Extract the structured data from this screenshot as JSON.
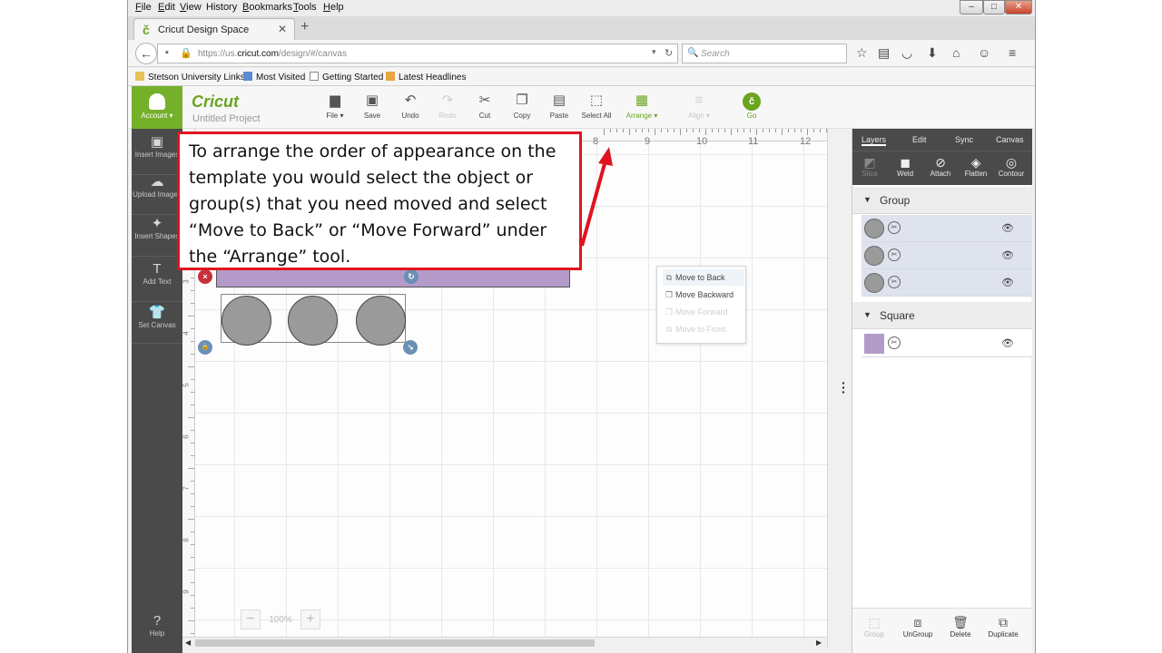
{
  "menubar": {
    "items": [
      {
        "key": "F",
        "rest": "ile"
      },
      {
        "key": "E",
        "rest": "dit"
      },
      {
        "key": "V",
        "rest": "iew"
      },
      {
        "key": "",
        "rest": "History"
      },
      {
        "key": "B",
        "rest": "ookmarks"
      },
      {
        "key": "T",
        "rest": "ools"
      },
      {
        "key": "H",
        "rest": "elp"
      }
    ]
  },
  "window_controls": {
    "minimize": "–",
    "maximize": "□",
    "close": "✕"
  },
  "tab": {
    "title": "Cricut Design Space",
    "favicon": "č",
    "close": "✕",
    "new_tab": "+"
  },
  "nav": {
    "url_prefix": "https://us.",
    "url_domain": "cricut.com",
    "url_rest": "/design/#/canvas",
    "search_placeholder": "Search",
    "icons": [
      "back-arrow-icon",
      "info-icon",
      "lock-icon",
      "reload-icon",
      "search-icon",
      "bookmark-star-icon",
      "reading-list-icon",
      "pocket-icon",
      "download-icon",
      "home-icon",
      "chat-icon",
      "menu-icon"
    ]
  },
  "bookmarks": [
    "Stetson University Links",
    "Most Visited",
    "Getting Started",
    "Latest Headlines"
  ],
  "app": {
    "account_label": "Account ▾",
    "logo_text": "Cricut",
    "project_name": "Untitled Project",
    "toolbar": [
      {
        "label": "File ▾",
        "icon": "▆",
        "state": "normal"
      },
      {
        "label": "Save",
        "icon": "▣",
        "state": "normal"
      },
      {
        "label": "Undo",
        "icon": "↶",
        "state": "normal"
      },
      {
        "label": "Redo",
        "icon": "↷",
        "state": "disabled"
      },
      {
        "label": "Cut",
        "icon": "✂",
        "state": "normal"
      },
      {
        "label": "Copy",
        "icon": "❐",
        "state": "normal"
      },
      {
        "label": "Paste",
        "icon": "▤",
        "state": "normal"
      },
      {
        "label": "Select All",
        "icon": "⬚",
        "state": "normal"
      },
      {
        "label": "Arrange ▾",
        "icon": "▦",
        "state": "active"
      },
      {
        "label": "Align ▾",
        "icon": "≡",
        "state": "disabled"
      },
      {
        "label": "Go",
        "icon": "č",
        "state": "go"
      }
    ],
    "sidebar": [
      {
        "label": "Insert Images",
        "icon": "▣"
      },
      {
        "label": "Upload Images",
        "icon": "☁"
      },
      {
        "label": "Insert Shapes",
        "icon": "✦"
      },
      {
        "label": "Add Text",
        "icon": "T"
      },
      {
        "label": "Set Canvas",
        "icon": "👕"
      },
      {
        "label": "Help",
        "icon": "?"
      }
    ]
  },
  "canvas": {
    "ruler_h": [
      "8",
      "9",
      "10",
      "11",
      "12"
    ],
    "ruler_v": [
      "3",
      "4",
      "5",
      "6",
      "7",
      "8",
      "9"
    ],
    "zoom": "100%",
    "zoom_minus": "−",
    "zoom_plus": "+",
    "handles": {
      "delete": "×",
      "rotate": "↻",
      "lock": "🔒",
      "resize": "↘"
    },
    "colors": {
      "rectangle": "#b49ac9",
      "circles": "#9a9a9a"
    }
  },
  "arrange_menu": [
    {
      "label": "Move to Back",
      "icon": "⧉",
      "state": "highlighted"
    },
    {
      "label": "Move Backward",
      "icon": "❐",
      "state": "normal"
    },
    {
      "label": "Move Forward",
      "icon": "❐",
      "state": "disabled"
    },
    {
      "label": "Move to Front",
      "icon": "⧉",
      "state": "disabled"
    }
  ],
  "panel": {
    "tabs": [
      "Layers",
      "Edit",
      "Sync",
      "Canvas"
    ],
    "tools": [
      {
        "label": "Slice",
        "icon": "◩",
        "state": "disabled"
      },
      {
        "label": "Weld",
        "icon": "◼",
        "state": "normal"
      },
      {
        "label": "Attach",
        "icon": "⊘",
        "state": "normal"
      },
      {
        "label": "Flatten",
        "icon": "◈",
        "state": "normal"
      },
      {
        "label": "Contour",
        "icon": "◎",
        "state": "normal"
      }
    ],
    "groups": [
      {
        "name": "Group",
        "layers": [
          "circle",
          "circle",
          "circle"
        ]
      },
      {
        "name": "Square",
        "layers": [
          "square"
        ]
      }
    ],
    "bottom": [
      {
        "label": "Group",
        "icon": "⬚",
        "state": "disabled"
      },
      {
        "label": "UnGroup",
        "icon": "⧈",
        "state": "normal"
      },
      {
        "label": "Delete",
        "icon": "🗑",
        "state": "normal"
      },
      {
        "label": "Duplicate",
        "icon": "⧉",
        "state": "normal"
      }
    ]
  },
  "callout": {
    "text": "To arrange the order of appearance on the template you would select the object or group(s) that you need moved and select “Move to Back” or “Move Forward” under the “Arrange” tool."
  },
  "accent": {
    "cricut_green": "#6aa51e",
    "callout_red": "#e0141e"
  }
}
